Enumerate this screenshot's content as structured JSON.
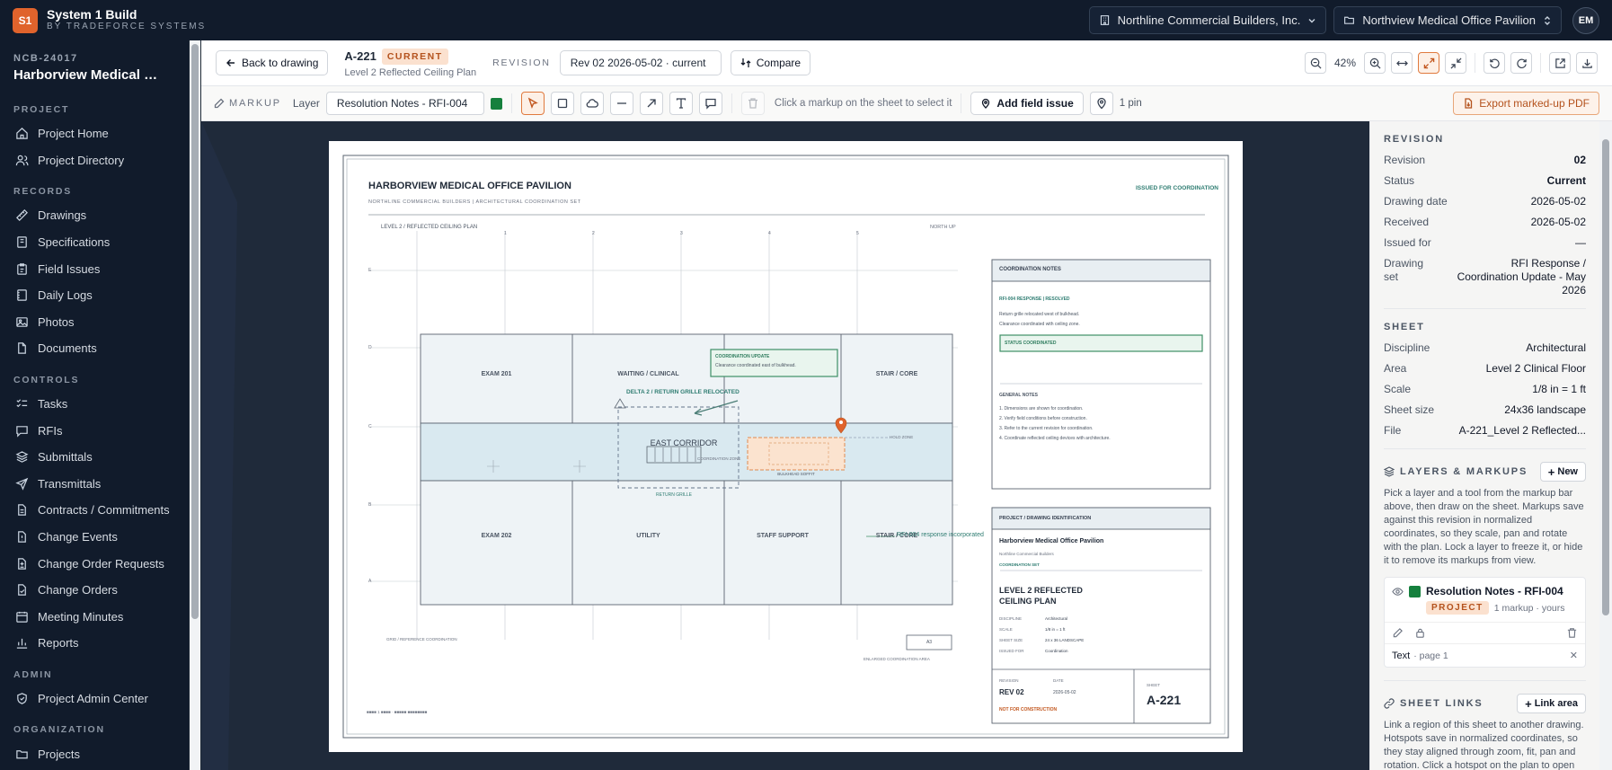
{
  "app": {
    "logo": "S1",
    "name": "System 1 Build",
    "sub": "BY TRADEFORCE SYSTEMS"
  },
  "topbar": {
    "company": "Northline Commercial Builders, Inc.",
    "project": "Northview Medical Office Pavilion",
    "avatar": "EM"
  },
  "sidebar": {
    "code": "NCB-24017",
    "project": "Harborview Medical Office Pavilion",
    "sections": [
      {
        "label": "PROJECT",
        "items": [
          "Project Home",
          "Project Directory"
        ]
      },
      {
        "label": "RECORDS",
        "items": [
          "Drawings",
          "Specifications",
          "Field Issues",
          "Daily Logs",
          "Photos",
          "Documents"
        ]
      },
      {
        "label": "CONTROLS",
        "items": [
          "Tasks",
          "RFIs",
          "Submittals",
          "Transmittals",
          "Contracts / Commitments",
          "Change Events",
          "Change Order Requests",
          "Change Orders",
          "Meeting Minutes",
          "Reports"
        ]
      },
      {
        "label": "ADMIN",
        "items": [
          "Project Admin Center"
        ]
      },
      {
        "label": "ORGANIZATION",
        "items": [
          "Projects"
        ]
      }
    ]
  },
  "header": {
    "back": "Back to drawing",
    "sheet_no": "A-221",
    "status_badge": "CURRENT",
    "sheet_title": "Level 2 Reflected Ceiling Plan",
    "revision_label": "REVISION",
    "revision_value": "Rev 02 2026-05-02 · current",
    "compare": "Compare",
    "zoom": "42%"
  },
  "markup_bar": {
    "label": "MARKUP",
    "layer_label": "Layer",
    "layer_value": "Resolution Notes - RFI-004",
    "hint": "Click a markup on the sheet to select it",
    "add_issue": "Add field issue",
    "pins": "1 pin",
    "export": "Export marked-up PDF"
  },
  "drawing": {
    "title": "HARBORVIEW MEDICAL OFFICE PAVILION",
    "subtitle": "NORTHLINE COMMERCIAL BUILDERS  |  ARCHITECTURAL COORDINATION SET",
    "issued": "ISSUED FOR COORDINATION",
    "plan_label": "LEVEL 2 / REFLECTED CEILING PLAN",
    "north": "NORTH UP",
    "cols": [
      "1",
      "2",
      "3",
      "4",
      "5"
    ],
    "rows": [
      "E",
      "D",
      "C",
      "B",
      "A"
    ],
    "rooms": {
      "exam201": "EXAM 201",
      "waiting": "WAITING / CLINICAL",
      "stair1": "STAIR / CORE",
      "corridor": "EAST CORRIDOR",
      "exam202": "EXAM 202",
      "utility": "UTILITY",
      "staff": "STAFF SUPPORT",
      "stair2": "STAIR / CORE"
    },
    "coord_update_title": "COORDINATION UPDATE",
    "coord_update_text": "Clearance coordinated east of bulkhead.",
    "delta": "DELTA 2 / RETURN GRILLE RELOCATED",
    "return_grille": "RETURN GRILLE",
    "coord_zone": "COORDINATION ZONE",
    "bulkhead": "BULKHEAD SOFFIT",
    "hold_zone": "HOLD ZONE",
    "rfi_text": "RFI-004 response incorporated",
    "grid_ref": "GRID / REFERENCE COORDINATION",
    "enlarged": "ENLARGED COORDINATION AREA",
    "a3": "A3",
    "footer_left": "SHEET 1 SCALE  —  MARKUP COORDINATION",
    "notes_title": "COORDINATION NOTES",
    "notes_sub": "RFI-004 RESPONSE  |  RESOLVED",
    "notes_l1": "Return grille relocated west of bulkhead.",
    "notes_l2": "Clearance coordinated with ceiling zone.",
    "status_box": "STATUS  COORDINATED",
    "gen_notes_title": "GENERAL NOTES",
    "gen_notes": [
      "1. Dimensions are shown for coordination.",
      "2. Verify field conditions before construction.",
      "3. Refer to the current revision for coordination.",
      "4. Coordinate reflected ceiling devices with architecture."
    ],
    "tb_header": "PROJECT / DRAWING IDENTIFICATION",
    "tb_project": "Harborview Medical Office Pavilion",
    "tb_client": "Northline Commercial Builders",
    "tb_set": "COORDINATION SET",
    "tb_title1": "LEVEL 2 REFLECTED",
    "tb_title2": "CEILING PLAN",
    "tb_fields": [
      [
        "DISCIPLINE",
        "Architectural"
      ],
      [
        "SCALE",
        "1/8 in = 1 ft"
      ],
      [
        "SHEET SIZE",
        "24 x 36 LANDSCAPE"
      ],
      [
        "ISSUED FOR",
        "Coordination"
      ]
    ],
    "tb_rev_label": "REVISION",
    "tb_date_label": "DATE",
    "tb_rev": "REV 02",
    "tb_date": "2026-05-02",
    "tb_sheet_label": "SHEET",
    "tb_sheet": "A-221",
    "tb_nfc": "NOT FOR CONSTRUCTION"
  },
  "panel": {
    "revision_title": "REVISION",
    "revision": [
      [
        "Revision",
        "02",
        true
      ],
      [
        "Status",
        "Current",
        true
      ],
      [
        "Drawing date",
        "2026-05-02",
        false
      ],
      [
        "Received",
        "2026-05-02",
        false
      ],
      [
        "Issued for",
        "—",
        false
      ],
      [
        "Drawing set",
        "RFI Response / Coordination Update - May 2026",
        false
      ]
    ],
    "sheet_title": "SHEET",
    "sheet": [
      [
        "Discipline",
        "Architectural"
      ],
      [
        "Area",
        "Level 2 Clinical Floor"
      ],
      [
        "Scale",
        "1/8 in = 1 ft"
      ],
      [
        "Sheet size",
        "24x36 landscape"
      ],
      [
        "File",
        "A-221_Level 2 Reflected..."
      ]
    ],
    "layers_title": "LAYERS & MARKUPS",
    "layers_new": "New",
    "layers_help": "Pick a layer and a tool from the markup bar above, then draw on the sheet. Markups save against this revision in normalized coordinates, so they scale, pan and rotate with the plan. Lock a layer to freeze it, or hide it to remove its markups from view.",
    "layer_name": "Resolution Notes - RFI-004",
    "layer_badge": "PROJECT",
    "layer_meta": "1 markup · yours",
    "layer_item_type": "Text",
    "layer_item_page": "· page 1",
    "links_title": "SHEET LINKS",
    "links_btn": "Link area",
    "links_help": "Link a region of this sheet to another drawing. Hotspots save in normalized coordinates, so they stay aligned through zoom, fit, pan and rotation. Click a hotspot on the plan to open its target."
  },
  "colors": {
    "accent": "#e0632c",
    "layer": "#15803d",
    "sidebar": "#111b2b"
  }
}
